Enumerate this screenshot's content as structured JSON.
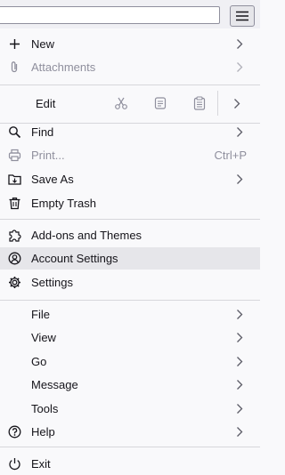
{
  "menu": {
    "items": [
      {
        "id": "new",
        "label": "New",
        "icon": "plus-icon"
      },
      {
        "id": "attachments",
        "label": "Attachments",
        "icon": "paperclip-icon"
      },
      {
        "id": "find",
        "label": "Find",
        "icon": "magnifier-icon"
      },
      {
        "id": "print",
        "label": "Print...",
        "icon": "printer-icon",
        "shortcut": "Ctrl+P"
      },
      {
        "id": "save-as",
        "label": "Save As",
        "icon": "folder-save-icon"
      },
      {
        "id": "empty-trash",
        "label": "Empty Trash",
        "icon": "trash-icon"
      },
      {
        "id": "addons",
        "label": "Add-ons and Themes",
        "icon": "puzzle-icon"
      },
      {
        "id": "account-settings",
        "label": "Account Settings",
        "icon": "account-icon"
      },
      {
        "id": "settings",
        "label": "Settings",
        "icon": "gear-icon"
      },
      {
        "id": "file",
        "label": "File"
      },
      {
        "id": "view",
        "label": "View"
      },
      {
        "id": "go",
        "label": "Go"
      },
      {
        "id": "message",
        "label": "Message"
      },
      {
        "id": "tools",
        "label": "Tools"
      },
      {
        "id": "help",
        "label": "Help",
        "icon": "help-icon"
      },
      {
        "id": "exit",
        "label": "Exit",
        "icon": "power-icon"
      }
    ],
    "edit": {
      "label": "Edit",
      "icons": [
        "scissors-icon",
        "copy-icon",
        "paste-icon"
      ]
    }
  },
  "colors": {
    "highlight": "#e6e6ea",
    "disabled": "#8f8f9d",
    "text": "#15141a"
  }
}
